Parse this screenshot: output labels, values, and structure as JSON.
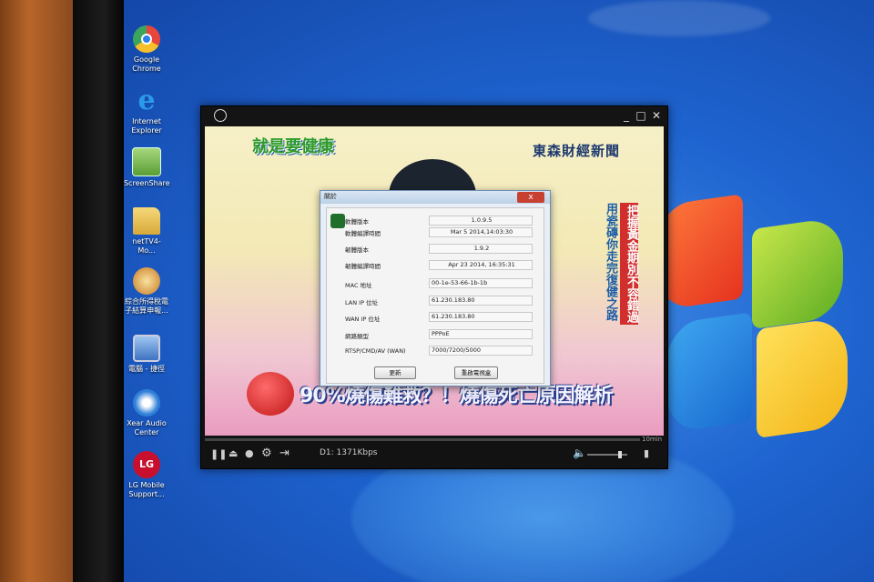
{
  "desktop": {
    "icons": [
      {
        "label": "Google Chrome",
        "icon": "chrome-icon",
        "color": "#e8453c"
      },
      {
        "label": "Internet Explorer",
        "icon": "ie-icon",
        "color": "#1e8fe0"
      },
      {
        "label": "ScreenShare",
        "icon": "screenshare-icon",
        "color": "#6fbf4a"
      },
      {
        "label": "netTV4-Mo...",
        "icon": "folder-icon",
        "color": "#e7c25a"
      },
      {
        "label": "綜合所得稅電子結算申報...",
        "icon": "tax-app-icon",
        "color": "#d9a13a"
      },
      {
        "label": "電腦 - 捷徑",
        "icon": "computer-icon",
        "color": "#5a8fd6"
      },
      {
        "label": "Xear Audio Center",
        "icon": "audio-icon",
        "color": "#2f7fd8"
      },
      {
        "label": "LG Mobile Support...",
        "icon": "lg-icon",
        "color": "#c8102e"
      }
    ]
  },
  "player": {
    "titlebar_icon": "globe-icon",
    "video": {
      "logo_text": "就是要健康",
      "channel_text": "東森財經新聞",
      "side_caption_1": "用瓷磚你走完復健之路",
      "side_caption_2": "把握黃金期別不容錯過",
      "headline": "90%燒傷難救？！燒傷死亡原因解析"
    },
    "controls": {
      "bitrate": "D1: 1371Kbps",
      "time_label": "10min"
    }
  },
  "about_dialog": {
    "title": "關於",
    "close_label": "x",
    "rows": [
      {
        "label": "軟體版本",
        "value": "1.0.9.5"
      },
      {
        "label": "軟體編譯時間",
        "value": "Mar  5 2014,14:03:30"
      },
      {
        "label": "韌體版本",
        "value": "1.9.2"
      },
      {
        "label": "韌體編譯時間",
        "value": "Apr 23 2014, 16:35:31"
      },
      {
        "label": "MAC 地址",
        "value": "00-1e-53-66-1b-1b"
      },
      {
        "label": "LAN IP 位址",
        "value": "61.230.183.80"
      },
      {
        "label": "WAN IP 位址",
        "value": "61.230.183.80"
      },
      {
        "label": "網路類型",
        "value": "PPPoE"
      },
      {
        "label": "RTSP/CMD/AV (WAN)",
        "value": "7000/7200/5000"
      }
    ],
    "update_button": "更新",
    "restart_button": "重啟電視盒"
  }
}
